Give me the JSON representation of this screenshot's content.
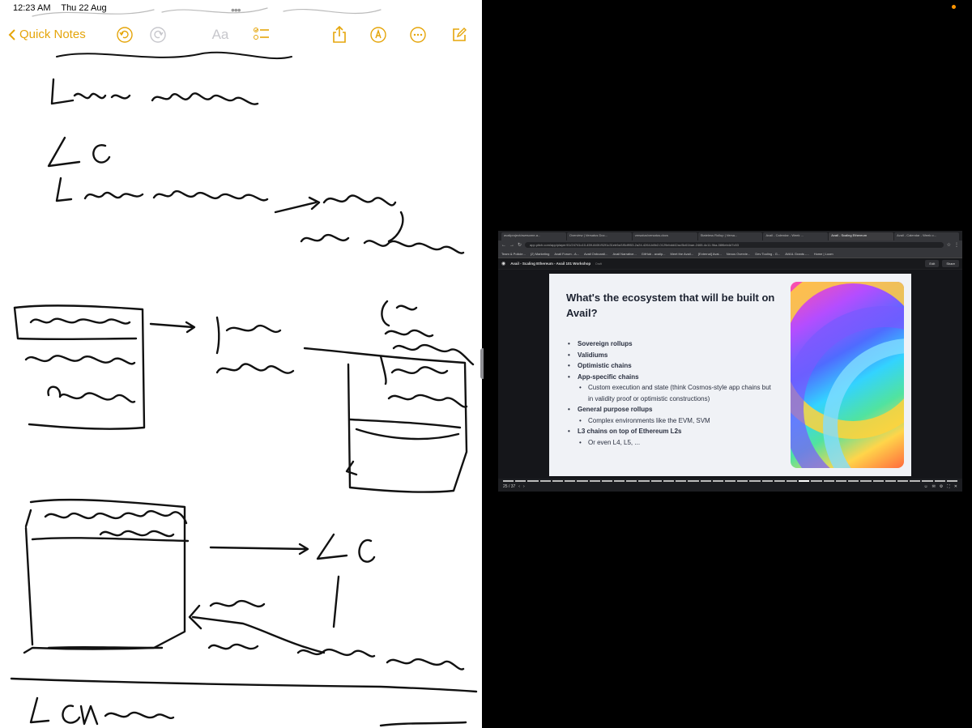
{
  "status_bar": {
    "time": "12:23 AM",
    "date": "Thu 22 Aug"
  },
  "notes": {
    "back_label": "Quick Notes",
    "font_label": "Aa",
    "accent_color": "#e5a50a"
  },
  "browser": {
    "tabs": [
      "availproject/awesome-a...",
      "Overview | Versatus Doc...",
      "versatus/versatus-docs",
      "Stateless Rollup | Versa...",
      "Avail - Calendar - Week ...",
      "Avail - Scaling Ethereum",
      "Avail - Calendar - Week o..."
    ],
    "url": "app.pitch.com/app/player/01/24741c10-459-840f-f52f1c31eb9a/1f5df953-2a24-4264-b8b2-0129ebdd42ac/5c61bae-2465-4c11-9ba-08f6eb4d7c53",
    "bookmarks": [
      "Team & Policie...",
      "(2) Marketing",
      "Avail Forum - A...",
      "Avail Onboardi...",
      "Avail Narrative...",
      "GitHub - availp...",
      "Meet the Avail...",
      "[External] Avai...",
      "Nexus Overvie...",
      "Dev Tooling - G...",
      "AVAIL Grants -...",
      "Home | Loom"
    ],
    "pitch_title": "Avail - Scaling Ethereum - Avail 101 Workshop",
    "pitch_sub": "Draft",
    "edit_label": "Edit",
    "share_label": "Share",
    "slide": {
      "title": "What's the ecosystem that will be built on Avail?",
      "bullets": [
        {
          "text": "Sovereign rollups",
          "level": 1
        },
        {
          "text": "Validiums",
          "level": 1
        },
        {
          "text": "Optimistic chains",
          "level": 1
        },
        {
          "text": "App-specific chains",
          "level": 1
        },
        {
          "text": "Custom execution and state (think Cosmos-style app chains but in validity proof or optimistic constructions)",
          "level": 2
        },
        {
          "text": "General purpose rollups",
          "level": 1
        },
        {
          "text": "Complex environments like the EVM, SVM",
          "level": 2
        },
        {
          "text": "L3 chains on top of Ethereum L2s",
          "level": 1
        },
        {
          "text": "Or even L4, L5, ...",
          "level": 2
        }
      ]
    },
    "pager": "25 / 37",
    "progress_current": 25,
    "progress_total": 37
  }
}
